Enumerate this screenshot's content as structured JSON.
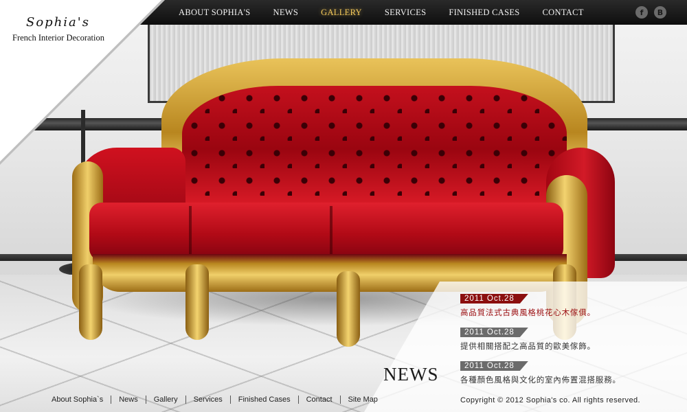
{
  "logo": {
    "script": "Sophia's",
    "tagline": "French Interior Decoration"
  },
  "nav": {
    "items": [
      {
        "label": "ABOUT SOPHIA'S",
        "active": false
      },
      {
        "label": "NEWS",
        "active": false
      },
      {
        "label": "GALLERY",
        "active": true
      },
      {
        "label": "SERVICES",
        "active": false
      },
      {
        "label": "FINISHED CASES",
        "active": false
      },
      {
        "label": "CONTACT",
        "active": false
      }
    ],
    "active_color": "#f3c85a"
  },
  "social": [
    {
      "icon": "facebook-icon",
      "glyph": "f"
    },
    {
      "icon": "blogger-icon",
      "glyph": "B"
    }
  ],
  "hero": {
    "image": "red-baroque-sofa-photo"
  },
  "news": {
    "heading": "NEWS",
    "items": [
      {
        "date": "2011 Oct.28",
        "text": "高品質法式古典風格桃花心木傢俱。",
        "highlight": true
      },
      {
        "date": "2011 Oct.28",
        "text": "提供相關搭配之高品質的歐美傢飾。",
        "highlight": false
      },
      {
        "date": "2011 Oct.28",
        "text": "各種顏色風格與文化的室內佈置混搭服務。",
        "highlight": false
      }
    ],
    "date_color_highlight": "#8b0f0f",
    "date_color_default": "#6b6b6b"
  },
  "footer": {
    "links": [
      "About Sophia`s",
      "News",
      "Gallery",
      "Services",
      "Finished Cases",
      "Contact",
      "Site Map"
    ],
    "copyright": "Copyright © 2012  Sophia's co. All rights reserved."
  }
}
